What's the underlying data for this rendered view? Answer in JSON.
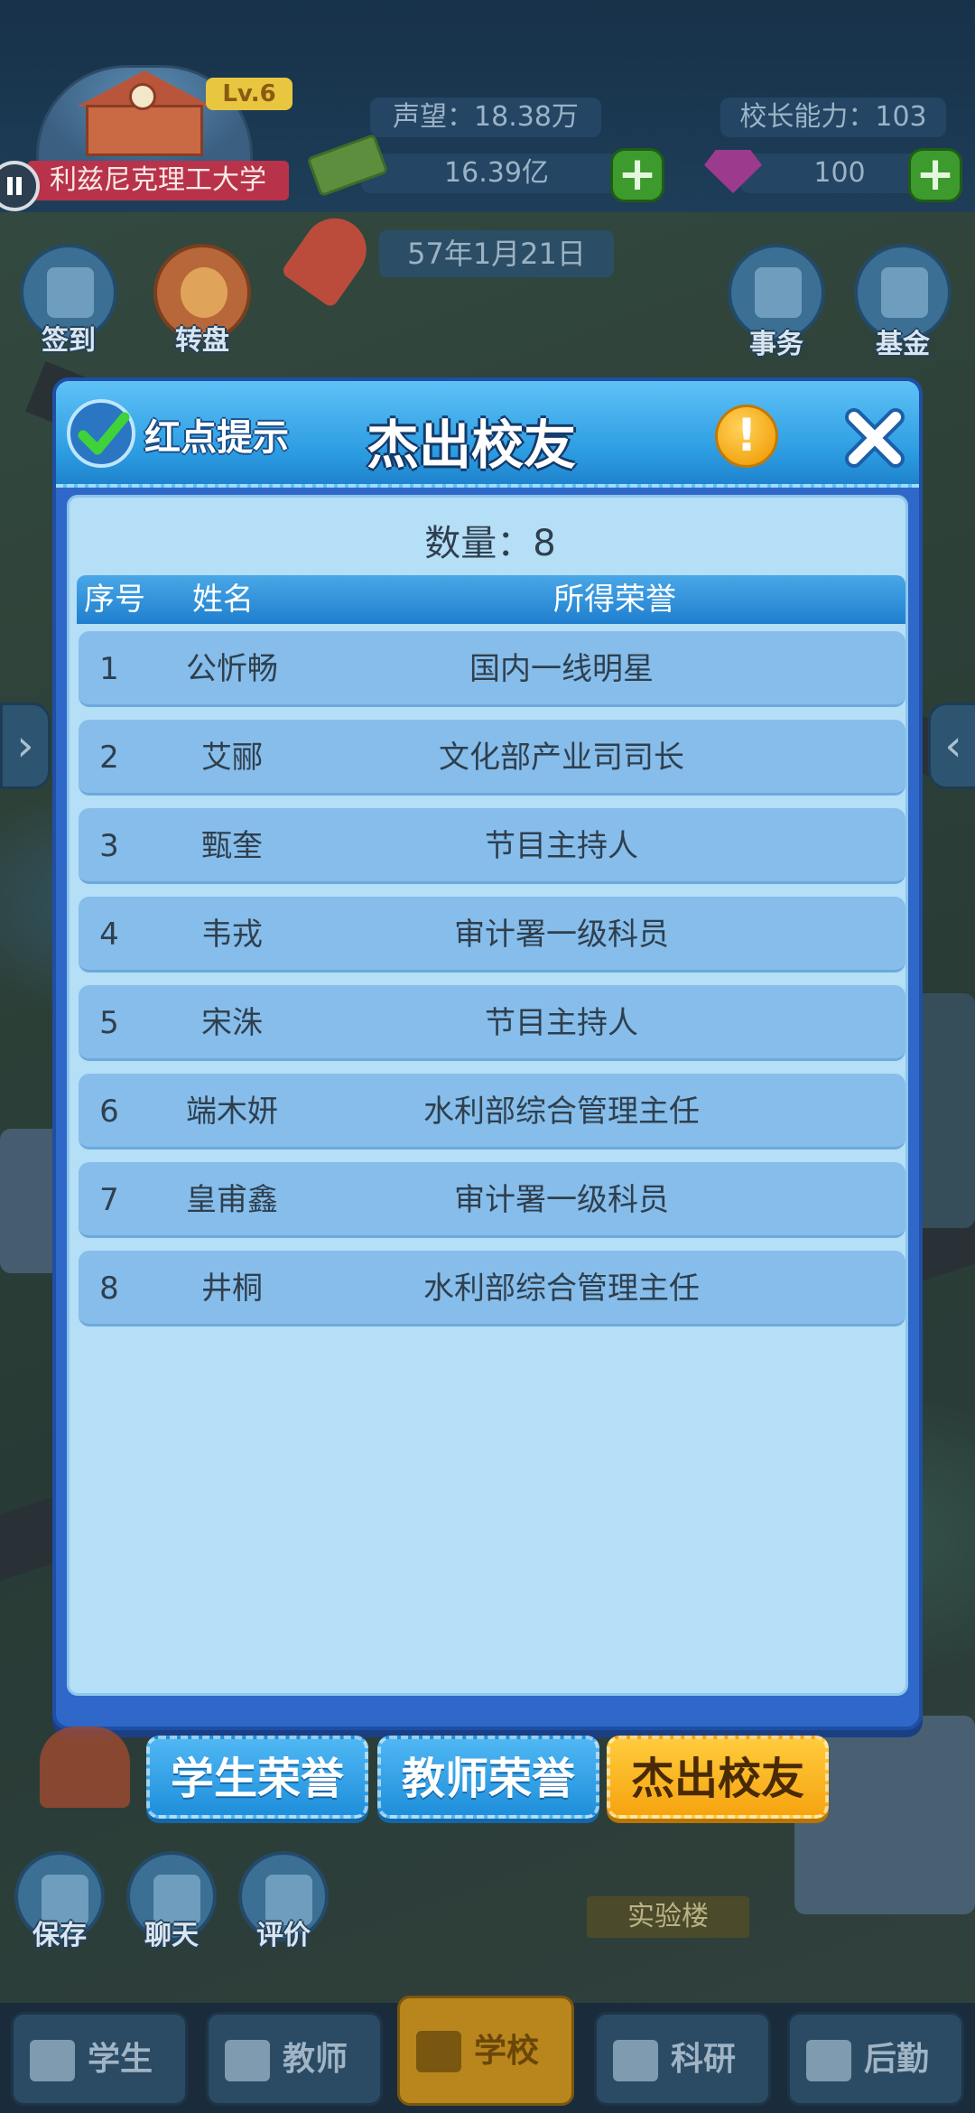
{
  "hud": {
    "level": "Lv.6",
    "school_name": "利兹尼克理工大学",
    "reputation": "声望：18.38万",
    "principal_ability": "校长能力：103",
    "money": "16.39亿",
    "gems": "100",
    "date": "57年1月21日"
  },
  "top_icons": [
    {
      "label": "签到",
      "icon": "checkin-icon"
    },
    {
      "label": "转盘",
      "icon": "wheel-icon"
    },
    {
      "label": "事务",
      "icon": "clipboard-icon"
    },
    {
      "label": "基金",
      "icon": "chart-up-icon"
    }
  ],
  "modal": {
    "redpoint_label": "红点提示",
    "title": "杰出校友",
    "count_text": "数量：8",
    "columns": [
      "序号",
      "姓名",
      "所得荣誉"
    ],
    "rows": [
      {
        "idx": "1",
        "name": "公忻畅",
        "honor": "国内一线明星"
      },
      {
        "idx": "2",
        "name": "艾郦",
        "honor": "文化部产业司司长"
      },
      {
        "idx": "3",
        "name": "甄奎",
        "honor": "节目主持人"
      },
      {
        "idx": "4",
        "name": "韦戎",
        "honor": "审计署一级科员"
      },
      {
        "idx": "5",
        "name": "宋洙",
        "honor": "节目主持人"
      },
      {
        "idx": "6",
        "name": "端木妍",
        "honor": "水利部综合管理主任"
      },
      {
        "idx": "7",
        "name": "皇甫鑫",
        "honor": "审计署一级科员"
      },
      {
        "idx": "8",
        "name": "井桐",
        "honor": "水利部综合管理主任"
      }
    ]
  },
  "tabs": [
    {
      "label": "学生荣誉",
      "active": false
    },
    {
      "label": "教师荣誉",
      "active": false
    },
    {
      "label": "杰出校友",
      "active": true
    }
  ],
  "side_icons": [
    {
      "label": "保存",
      "icon": "save-icon"
    },
    {
      "label": "聊天",
      "icon": "chat-icon"
    },
    {
      "label": "评价",
      "icon": "review-icon"
    }
  ],
  "lab_sign": "实验楼",
  "bottom_nav": [
    {
      "label": "学生",
      "icon": "graduation-cap-icon"
    },
    {
      "label": "教师",
      "icon": "teacher-icon"
    },
    {
      "label": "学校",
      "icon": "school-building-icon"
    },
    {
      "label": "科研",
      "icon": "microscope-icon"
    },
    {
      "label": "后勤",
      "icon": "logistics-icon"
    }
  ],
  "colors": {
    "modal_frame": "#2f68c9",
    "modal_body": "#b5def7",
    "row_bg": "#86bdea",
    "tab_active": "#f6a410",
    "tab_inactive": "#1f8fdb"
  }
}
